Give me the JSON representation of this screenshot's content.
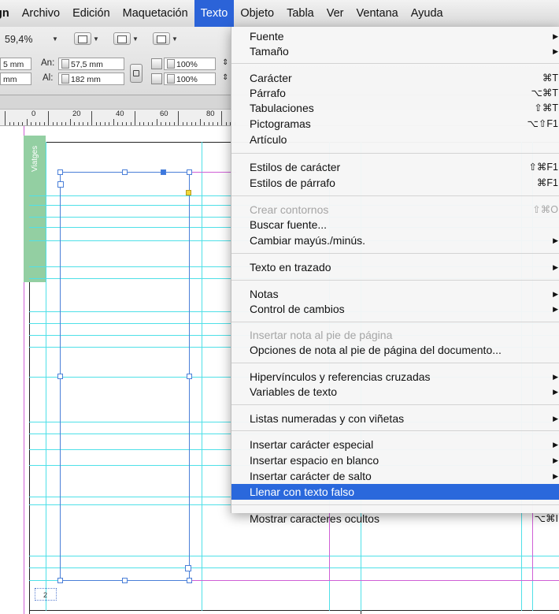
{
  "menubar": {
    "items": [
      "gn",
      "Archivo",
      "Edición",
      "Maquetación",
      "Texto",
      "Objeto",
      "Tabla",
      "Ver",
      "Ventana",
      "Ayuda"
    ]
  },
  "control": {
    "zoom": "59,4%",
    "x_partial": "5 mm",
    "y_partial": "mm",
    "an_label": "An:",
    "an_value": "57,5 mm",
    "al_label": "Al:",
    "al_value": "182 mm",
    "scale_x": "100%",
    "scale_y": "100%"
  },
  "ruler": {
    "labels": [
      "0",
      "20",
      "40",
      "60",
      "80"
    ]
  },
  "document": {
    "tab_label": "Viatges",
    "page_number": "2"
  },
  "menu": {
    "items": [
      {
        "label": "Fuente",
        "shortcut": "",
        "submenu": true,
        "disabled": false
      },
      {
        "label": "Tamaño",
        "shortcut": "",
        "submenu": true,
        "disabled": false
      },
      {
        "label": "Carácter",
        "shortcut": "⌘T",
        "submenu": false,
        "disabled": false
      },
      {
        "label": "Párrafo",
        "shortcut": "⌥⌘T",
        "submenu": false,
        "disabled": false
      },
      {
        "label": "Tabulaciones",
        "shortcut": "⇧⌘T",
        "submenu": false,
        "disabled": false
      },
      {
        "label": "Pictogramas",
        "shortcut": "⌥⇧F1",
        "submenu": false,
        "disabled": false
      },
      {
        "label": "Artículo",
        "shortcut": "",
        "submenu": false,
        "disabled": false
      },
      {
        "label": "Estilos de carácter",
        "shortcut": "⇧⌘F1",
        "submenu": false,
        "disabled": false
      },
      {
        "label": "Estilos de párrafo",
        "shortcut": "⌘F1",
        "submenu": false,
        "disabled": false
      },
      {
        "label": "Crear contornos",
        "shortcut": "⇧⌘O",
        "submenu": false,
        "disabled": true
      },
      {
        "label": "Buscar fuente...",
        "shortcut": "",
        "submenu": false,
        "disabled": false
      },
      {
        "label": "Cambiar mayús./minús.",
        "shortcut": "",
        "submenu": true,
        "disabled": false
      },
      {
        "label": "Texto en trazado",
        "shortcut": "",
        "submenu": true,
        "disabled": false
      },
      {
        "label": "Notas",
        "shortcut": "",
        "submenu": true,
        "disabled": false
      },
      {
        "label": "Control de cambios",
        "shortcut": "",
        "submenu": true,
        "disabled": false
      },
      {
        "label": "Insertar nota al pie de página",
        "shortcut": "",
        "submenu": false,
        "disabled": true
      },
      {
        "label": "Opciones de nota al pie de página del documento...",
        "shortcut": "",
        "submenu": false,
        "disabled": false
      },
      {
        "label": "Hipervínculos y referencias cruzadas",
        "shortcut": "",
        "submenu": true,
        "disabled": false
      },
      {
        "label": "Variables de texto",
        "shortcut": "",
        "submenu": true,
        "disabled": false
      },
      {
        "label": "Listas numeradas y con viñetas",
        "shortcut": "",
        "submenu": true,
        "disabled": false
      },
      {
        "label": "Insertar carácter especial",
        "shortcut": "",
        "submenu": true,
        "disabled": false
      },
      {
        "label": "Insertar espacio en blanco",
        "shortcut": "",
        "submenu": true,
        "disabled": false
      },
      {
        "label": "Insertar carácter de salto",
        "shortcut": "",
        "submenu": true,
        "disabled": false
      },
      {
        "label": "Llenar con texto falso",
        "shortcut": "",
        "submenu": false,
        "disabled": false,
        "highlighted": true
      },
      {
        "label": "Mostrar caracteres ocultos",
        "shortcut": "⌥⌘I",
        "submenu": false,
        "disabled": false
      }
    ]
  },
  "colors": {
    "menu_highlight": "#2a68dc",
    "guide_cyan": "#4fe0e8",
    "guide_magenta": "#cf5fd6",
    "frame_blue": "#4a7fd8",
    "tab_green": "#93cfa2"
  }
}
